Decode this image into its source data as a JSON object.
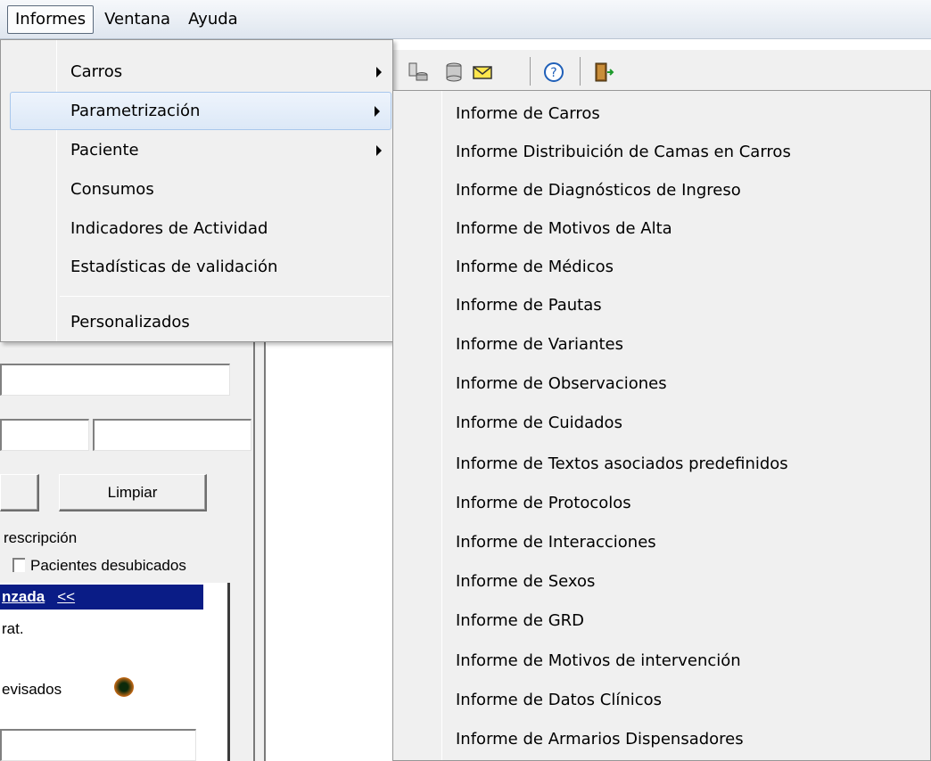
{
  "menubar": {
    "items": [
      "Informes",
      "Ventana",
      "Ayuda"
    ]
  },
  "toolbar": {
    "icons": [
      "database-connect-icon",
      "database-icon",
      "mail-icon",
      "help-icon",
      "exit-door-icon"
    ]
  },
  "informes_menu": {
    "items": [
      {
        "label": "Carros",
        "submenu": true
      },
      {
        "label": "Parametrización",
        "submenu": true,
        "highlighted": true
      },
      {
        "label": "Paciente",
        "submenu": true
      },
      {
        "label": "Consumos",
        "submenu": false
      },
      {
        "label": "Indicadores de Actividad",
        "submenu": false
      },
      {
        "label": "Estadísticas de validación",
        "submenu": false
      },
      {
        "label": "Personalizados",
        "submenu": false
      }
    ]
  },
  "parametrizacion_submenu": {
    "items": [
      "Informe de Carros",
      "Informe Distribuición de Camas en Carros",
      "Informe de Diagnósticos de Ingreso",
      "Informe de Motivos de Alta",
      "Informe de Médicos",
      "Informe de Pautas",
      "Informe de Variantes",
      "Informe de Observaciones",
      "Informe de Cuidados",
      "Informe de Textos asociados predefinidos",
      "Informe de Protocolos",
      "Informe de Interacciones",
      "Informe de Sexos",
      "Informe de GRD",
      "Informe de Motivos de intervención",
      "Informe de Datos Clínicos",
      "Informe de Armarios Dispensadores"
    ]
  },
  "background": {
    "limpiar_label": "Limpiar",
    "prescripcion_text": "rescripción",
    "pacientes_desubicados_label": "Pacientes desubicados",
    "header_text": "nzada",
    "header_toggle": "<<",
    "rat_text": "rat.",
    "revisados_text": "evisados"
  },
  "colors": {
    "header_bar": "#0a1c86",
    "menu_background": "#f0f0f0",
    "highlight": "#dce8f7"
  }
}
